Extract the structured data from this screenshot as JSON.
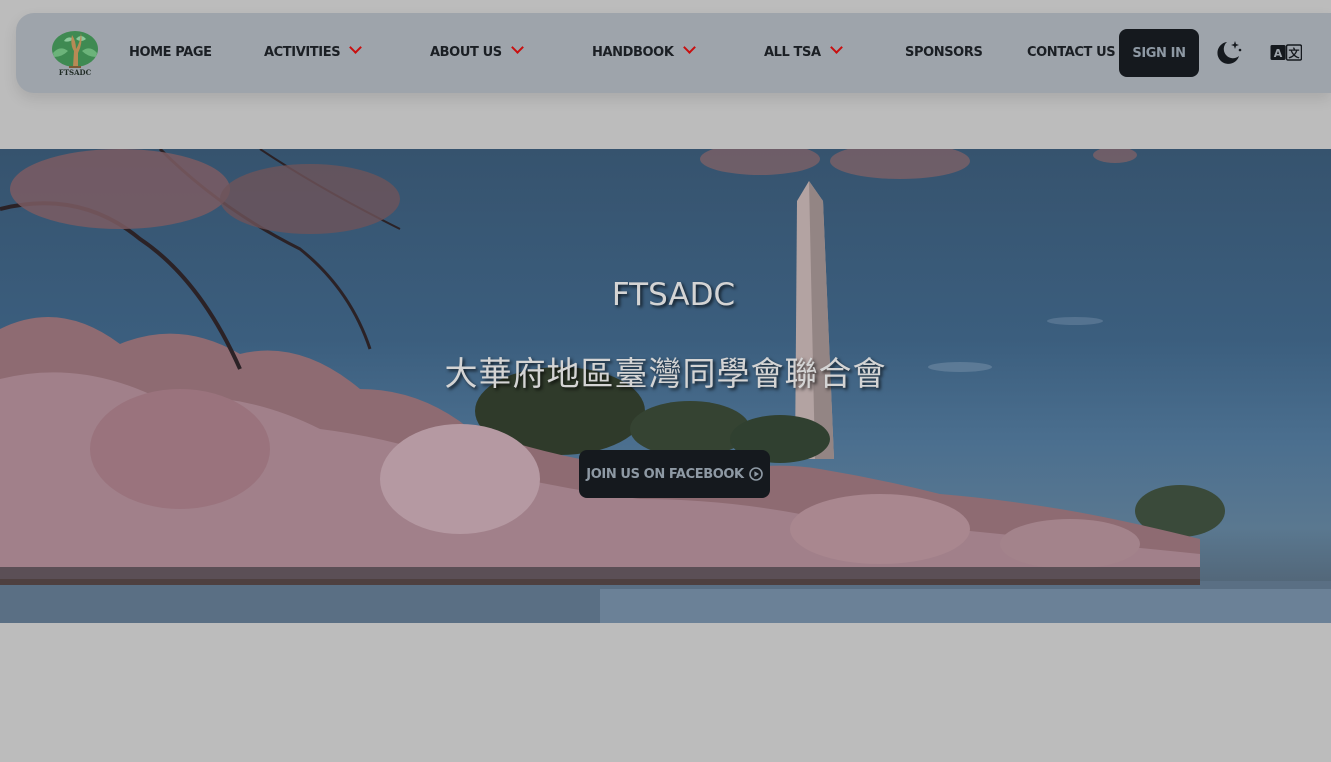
{
  "brand": {
    "logo_text": "FTSADC"
  },
  "nav": {
    "items": [
      {
        "label": "HOME PAGE",
        "has_dropdown": false
      },
      {
        "label": "ACTIVITIES",
        "has_dropdown": true
      },
      {
        "label": "ABOUT US",
        "has_dropdown": true
      },
      {
        "label": "HANDBOOK",
        "has_dropdown": true
      },
      {
        "label": "ALL TSA",
        "has_dropdown": true
      },
      {
        "label": "SPONSORS",
        "has_dropdown": false
      },
      {
        "label": "CONTACT US",
        "has_dropdown": false
      }
    ],
    "sign_in": "SIGN IN",
    "theme_icon": "moon-stars-icon",
    "language_icon": "translate-icon",
    "dropdown_caret_color": "#c90f0f"
  },
  "hero": {
    "title": "FTSADC",
    "subtitle": "大華府地區臺灣同學會聯合會",
    "cta_label": "JOIN US ON FACEBOOK",
    "cta_icon": "play-circle-icon"
  },
  "colors": {
    "navbar_bg": "#9ea4ab",
    "button_bg": "#15191e",
    "button_text": "#8e99a4",
    "page_bg": "#bcbcbc"
  }
}
